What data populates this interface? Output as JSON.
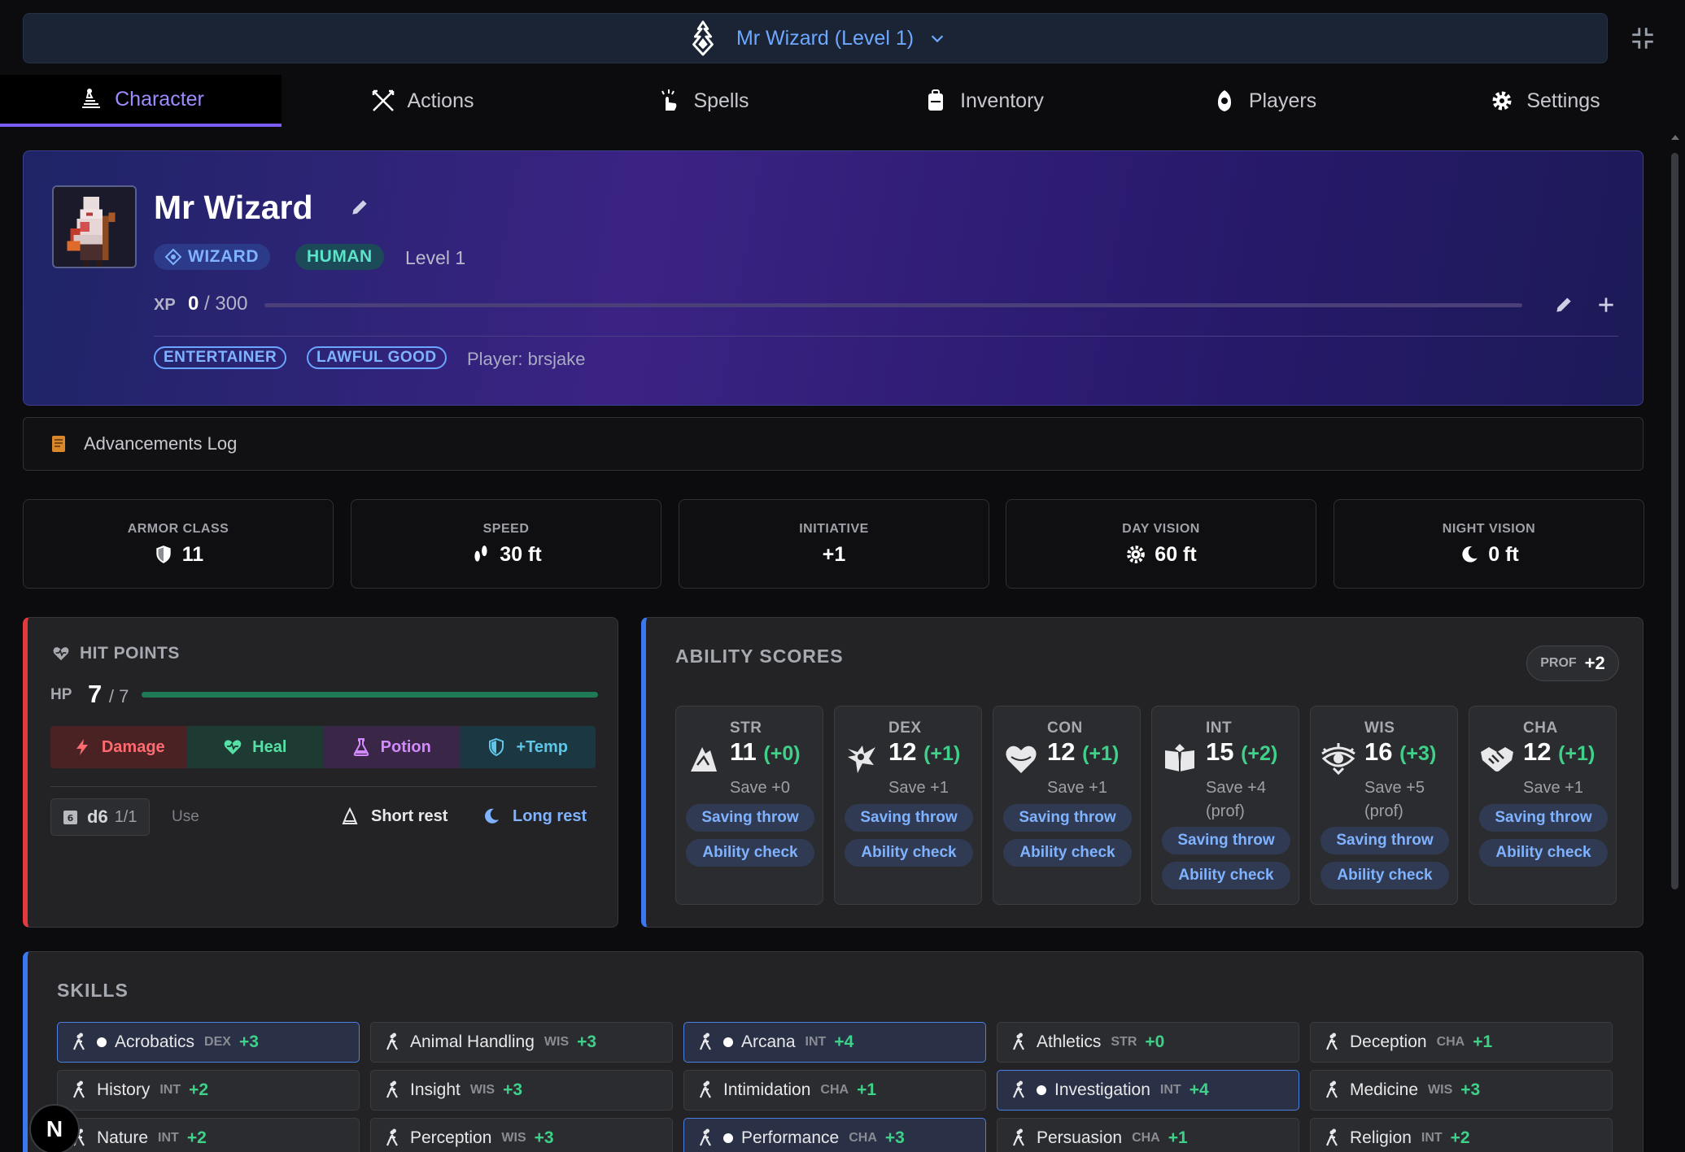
{
  "header": {
    "title": "Mr Wizard (Level 1)"
  },
  "tabs": [
    {
      "label": "Character",
      "icon": "character-icon",
      "active": true
    },
    {
      "label": "Actions",
      "icon": "crossed-swords-icon"
    },
    {
      "label": "Spells",
      "icon": "spell-hand-icon"
    },
    {
      "label": "Inventory",
      "icon": "backpack-icon"
    },
    {
      "label": "Players",
      "icon": "players-icon"
    },
    {
      "label": "Settings",
      "icon": "gear-icon"
    }
  ],
  "character": {
    "name": "Mr Wizard",
    "class": "WIZARD",
    "race": "HUMAN",
    "level": "Level 1",
    "xp_label": "XP",
    "xp_current": "0",
    "xp_max": "/ 300",
    "xp_progress": 0,
    "background": "ENTERTAINER",
    "alignment": "LAWFUL GOOD",
    "player": "Player: brsjake"
  },
  "advancements": {
    "label": "Advancements Log"
  },
  "stats": [
    {
      "label": "ARMOR CLASS",
      "value": "11",
      "icon": "shield-icon"
    },
    {
      "label": "SPEED",
      "value": "30 ft",
      "icon": "footprints-icon"
    },
    {
      "label": "INITIATIVE",
      "value": "+1",
      "icon": ""
    },
    {
      "label": "DAY VISION",
      "value": "60 ft",
      "icon": "sun-icon"
    },
    {
      "label": "NIGHT VISION",
      "value": "0 ft",
      "icon": "moon-icon"
    }
  ],
  "hit_points": {
    "title": "HIT POINTS",
    "hp_label": "HP",
    "current": "7",
    "max": "/ 7",
    "progress": 1.0,
    "buttons": {
      "damage": "Damage",
      "heal": "Heal",
      "potion": "Potion",
      "temp": "+Temp"
    },
    "hit_die": "d6",
    "hit_die_count": "1/1",
    "use_label": "Use",
    "short_rest": "Short rest",
    "long_rest": "Long rest"
  },
  "abilities": {
    "title": "ABILITY SCORES",
    "prof_label": "PROF",
    "prof_value": "+2",
    "saving_throw_label": "Saving throw",
    "ability_check_label": "Ability check",
    "scores": [
      {
        "abbr": "STR",
        "score": "11",
        "mod": "(+0)",
        "save": "Save +0",
        "prof": ""
      },
      {
        "abbr": "DEX",
        "score": "12",
        "mod": "(+1)",
        "save": "Save +1",
        "prof": ""
      },
      {
        "abbr": "CON",
        "score": "12",
        "mod": "(+1)",
        "save": "Save +1",
        "prof": ""
      },
      {
        "abbr": "INT",
        "score": "15",
        "mod": "(+2)",
        "save": "Save +4",
        "prof": "(prof)"
      },
      {
        "abbr": "WIS",
        "score": "16",
        "mod": "(+3)",
        "save": "Save +5",
        "prof": "(prof)"
      },
      {
        "abbr": "CHA",
        "score": "12",
        "mod": "(+1)",
        "save": "Save +1",
        "prof": ""
      }
    ]
  },
  "skills": {
    "title": "SKILLS",
    "items": [
      {
        "name": "Acrobatics",
        "ability": "DEX",
        "mod": "+3",
        "proficient": true
      },
      {
        "name": "Animal Handling",
        "ability": "WIS",
        "mod": "+3",
        "proficient": false
      },
      {
        "name": "Arcana",
        "ability": "INT",
        "mod": "+4",
        "proficient": true
      },
      {
        "name": "Athletics",
        "ability": "STR",
        "mod": "+0",
        "proficient": false
      },
      {
        "name": "Deception",
        "ability": "CHA",
        "mod": "+1",
        "proficient": false
      },
      {
        "name": "History",
        "ability": "INT",
        "mod": "+2",
        "proficient": false
      },
      {
        "name": "Insight",
        "ability": "WIS",
        "mod": "+3",
        "proficient": false
      },
      {
        "name": "Intimidation",
        "ability": "CHA",
        "mod": "+1",
        "proficient": false
      },
      {
        "name": "Investigation",
        "ability": "INT",
        "mod": "+4",
        "proficient": true
      },
      {
        "name": "Medicine",
        "ability": "WIS",
        "mod": "+3",
        "proficient": false
      },
      {
        "name": "Nature",
        "ability": "INT",
        "mod": "+2",
        "proficient": false
      },
      {
        "name": "Perception",
        "ability": "WIS",
        "mod": "+3",
        "proficient": false
      },
      {
        "name": "Performance",
        "ability": "CHA",
        "mod": "+3",
        "proficient": true
      },
      {
        "name": "Persuasion",
        "ability": "CHA",
        "mod": "+1",
        "proficient": false
      },
      {
        "name": "Religion",
        "ability": "INT",
        "mod": "+2",
        "proficient": false
      }
    ]
  },
  "fab": {
    "label": "N"
  },
  "colors": {
    "accent": "#7b5cf5",
    "link": "#7fb2ff",
    "positive": "#3fd089",
    "hp_border": "#e0393e",
    "panel_border": "#3b78f0"
  }
}
